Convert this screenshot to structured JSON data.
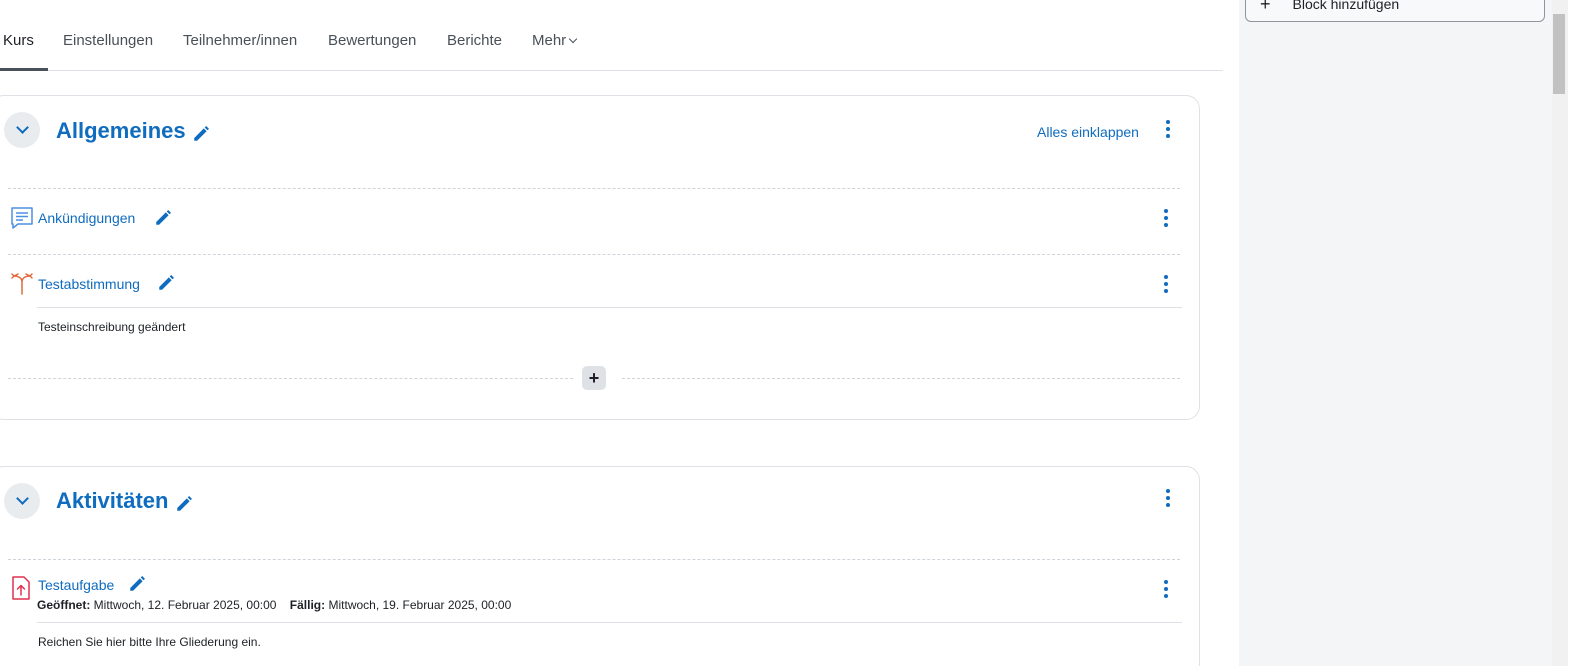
{
  "tabs": [
    {
      "label": "Kurs",
      "active": true
    },
    {
      "label": "Einstellungen"
    },
    {
      "label": "Teilnehmer/innen"
    },
    {
      "label": "Bewertungen"
    },
    {
      "label": "Berichte"
    },
    {
      "label": "Mehr"
    }
  ],
  "drawer": {
    "add_block_label": "Block hinzufügen"
  },
  "sections": [
    {
      "title": "Allgemeines",
      "collapse_all_label": "Alles einklappen",
      "activities": [
        {
          "name": "Ankündigungen",
          "icon": "forum-icon"
        },
        {
          "name": "Testabstimmung",
          "icon": "choice-icon",
          "description": "Testeinschreibung geändert"
        }
      ]
    },
    {
      "title": "Aktivitäten",
      "activities": [
        {
          "name": "Testaufgabe",
          "icon": "assignment-icon",
          "opened_label": "Geöffnet:",
          "opened_value": "Mittwoch, 12. Februar 2025, 00:00",
          "due_label": "Fällig:",
          "due_value": "Mittwoch, 19. Februar 2025, 00:00",
          "description": "Reichen Sie hier bitte Ihre Gliederung ein."
        }
      ]
    }
  ],
  "colors": {
    "link": "#0f6cbf",
    "choice_icon": "#e06a3c",
    "assign_icon": "#e0314f",
    "forum_icon": "#4a90e2"
  }
}
